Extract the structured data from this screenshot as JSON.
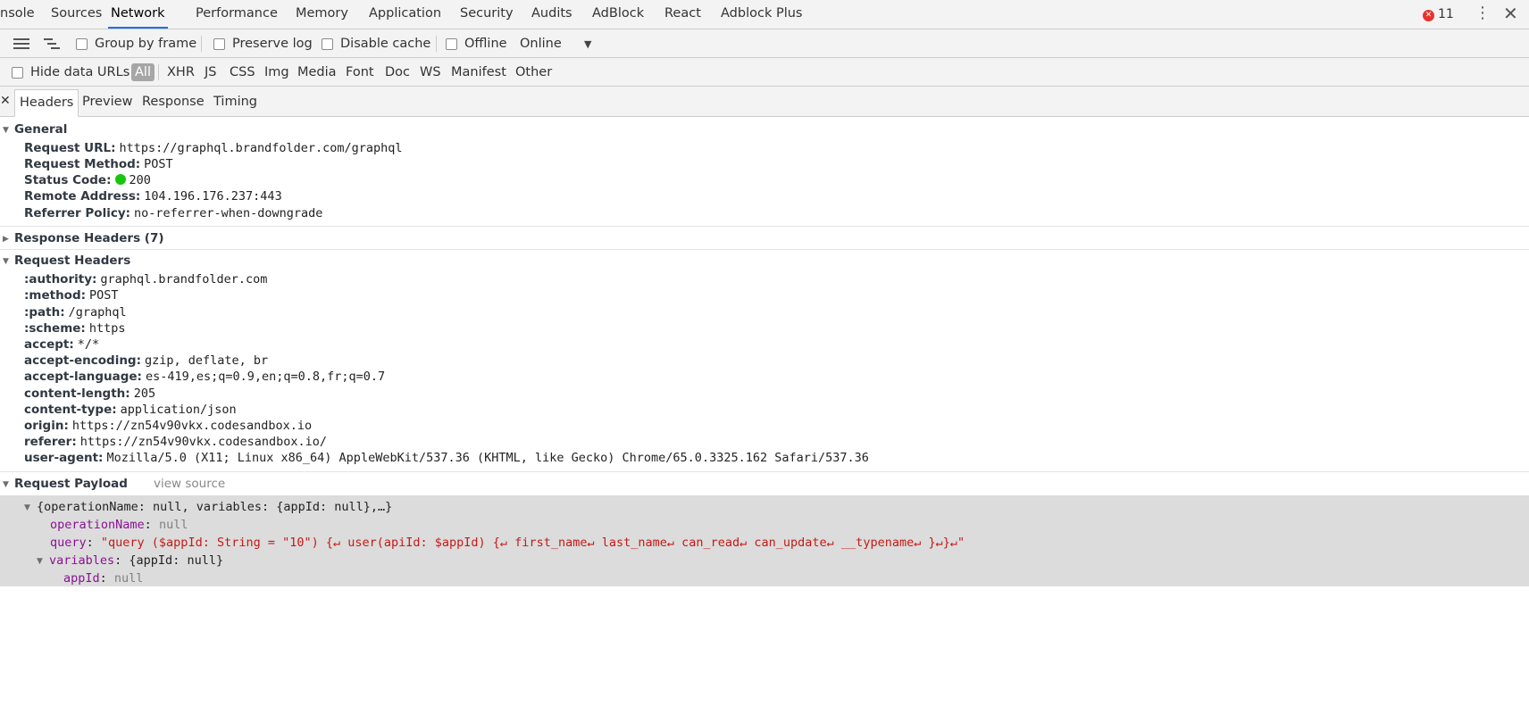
{
  "tabbar": {
    "tabs": [
      "nsole",
      "Sources",
      "Network",
      "Performance",
      "Memory",
      "Application",
      "Security",
      "Audits",
      "AdBlock",
      "React",
      "Adblock Plus"
    ],
    "error_count": "11"
  },
  "toolbar": {
    "group_by_frame": "Group by frame",
    "preserve_log": "Preserve log",
    "disable_cache": "Disable cache",
    "offline": "Offline",
    "throttle_value": "Online"
  },
  "filterbar": {
    "hide_data_urls": "Hide data URLs",
    "filters": [
      "All",
      "XHR",
      "JS",
      "CSS",
      "Img",
      "Media",
      "Font",
      "Doc",
      "WS",
      "Manifest",
      "Other"
    ]
  },
  "detail_tabs": [
    "Headers",
    "Preview",
    "Response",
    "Timing"
  ],
  "general": {
    "title": "General",
    "rows": [
      {
        "key": "Request URL:",
        "value": "https://graphql.brandfolder.com/graphql"
      },
      {
        "key": "Request Method:",
        "value": "POST"
      },
      {
        "key": "Status Code:",
        "value": "200"
      },
      {
        "key": "Remote Address:",
        "value": "104.196.176.237:443"
      },
      {
        "key": "Referrer Policy:",
        "value": "no-referrer-when-downgrade"
      }
    ]
  },
  "response_headers": {
    "title": "Response Headers (7)"
  },
  "request_headers": {
    "title": "Request Headers",
    "rows": [
      {
        "key": ":authority:",
        "value": "graphql.brandfolder.com"
      },
      {
        "key": ":method:",
        "value": "POST"
      },
      {
        "key": ":path:",
        "value": "/graphql"
      },
      {
        "key": ":scheme:",
        "value": "https"
      },
      {
        "key": "accept:",
        "value": "*/*"
      },
      {
        "key": "accept-encoding:",
        "value": "gzip, deflate, br"
      },
      {
        "key": "accept-language:",
        "value": "es-419,es;q=0.9,en;q=0.8,fr;q=0.7"
      },
      {
        "key": "content-length:",
        "value": "205"
      },
      {
        "key": "content-type:",
        "value": "application/json"
      },
      {
        "key": "origin:",
        "value": "https://zn54v90vkx.codesandbox.io"
      },
      {
        "key": "referer:",
        "value": "https://zn54v90vkx.codesandbox.io/"
      },
      {
        "key": "user-agent:",
        "value": "Mozilla/5.0 (X11; Linux x86_64) AppleWebKit/537.36 (KHTML, like Gecko) Chrome/65.0.3325.162 Safari/537.36"
      }
    ]
  },
  "payload": {
    "title": "Request Payload",
    "view_source": "view source",
    "root_summary": "{operationName: null, variables: {appId: null},…}",
    "operation_key": "operationName",
    "operation_value": "null",
    "query_key": "query",
    "query_value": "\"query ($appId: String = \"10\") {↵  user(apiId: $appId) {↵    first_name↵    last_name↵    can_read↵    can_update↵    __typename↵  }↵}↵\"",
    "variables_key": "variables",
    "variables_summary": "{appId: null}",
    "appid_key": "appId",
    "appid_value": "null"
  },
  "colors": {
    "active_tab_underline": "#1a73e8",
    "status_ok": "#16c60c",
    "error_badge": "#e8322c",
    "json_key": "#881391",
    "json_string": "#c41a16"
  }
}
